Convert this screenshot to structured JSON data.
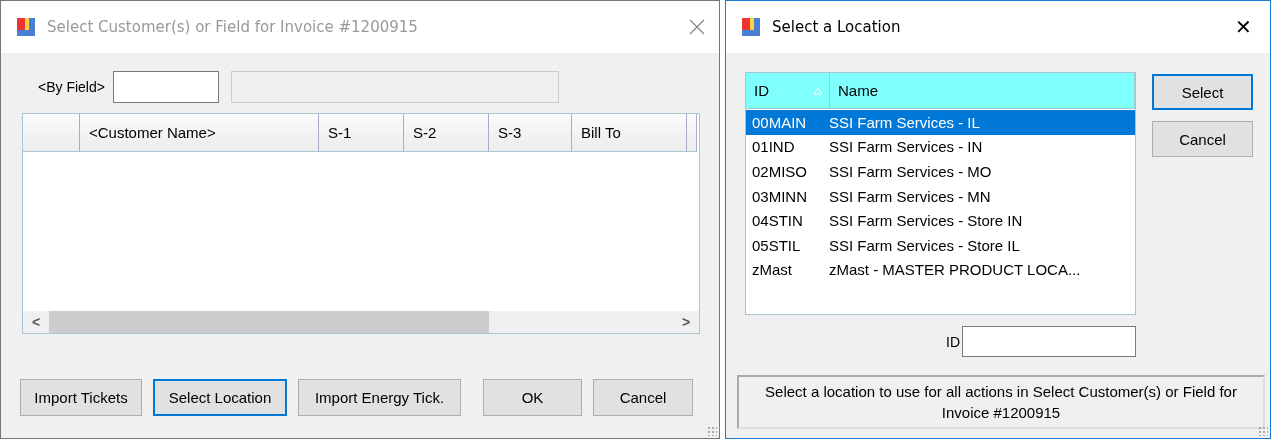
{
  "customer_window": {
    "title": "Select Customer(s) or Field for Invoice #1200915",
    "active": false,
    "by_field": {
      "label": "<By Field>"
    },
    "grid": {
      "columns": [
        "<Customer Name>",
        "S-1",
        "S-2",
        "S-3",
        "Bill To"
      ]
    },
    "scroll_left": "<",
    "scroll_right": ">",
    "buttons": [
      {
        "label": "Import Tickets",
        "focused": false
      },
      {
        "label": "Select Location",
        "focused": true
      },
      {
        "label": "Import Energy Tick.",
        "focused": false
      },
      {
        "label": "OK",
        "focused": false
      },
      {
        "label": "Cancel",
        "focused": false
      }
    ]
  },
  "location_window": {
    "title": "Select a Location",
    "close": "✕",
    "active": true,
    "columns": [
      "ID",
      "Name"
    ],
    "rows": [
      {
        "id": "00MAIN",
        "name": "SSI Farm Services - IL",
        "selected": true
      },
      {
        "id": "01IND",
        "name": "SSI Farm Services - IN",
        "selected": false
      },
      {
        "id": "02MISO",
        "name": "SSI Farm Services - MO",
        "selected": false
      },
      {
        "id": "03MINN",
        "name": "SSI Farm Services - MN",
        "selected": false
      },
      {
        "id": "04STIN",
        "name": "SSI Farm Services - Store IN",
        "selected": false
      },
      {
        "id": "05STIL",
        "name": "SSI Farm Services - Store IL",
        "selected": false
      },
      {
        "id": "zMast",
        "name": "zMast - MASTER PRODUCT LOCA...",
        "selected": false
      }
    ],
    "buttons": [
      {
        "label": "Select",
        "focused": true
      },
      {
        "label": "Cancel",
        "focused": false
      }
    ],
    "id_label": "ID",
    "info": "Select a location to use for all actions in Select Customer(s) or Field for Invoice #1200915"
  }
}
